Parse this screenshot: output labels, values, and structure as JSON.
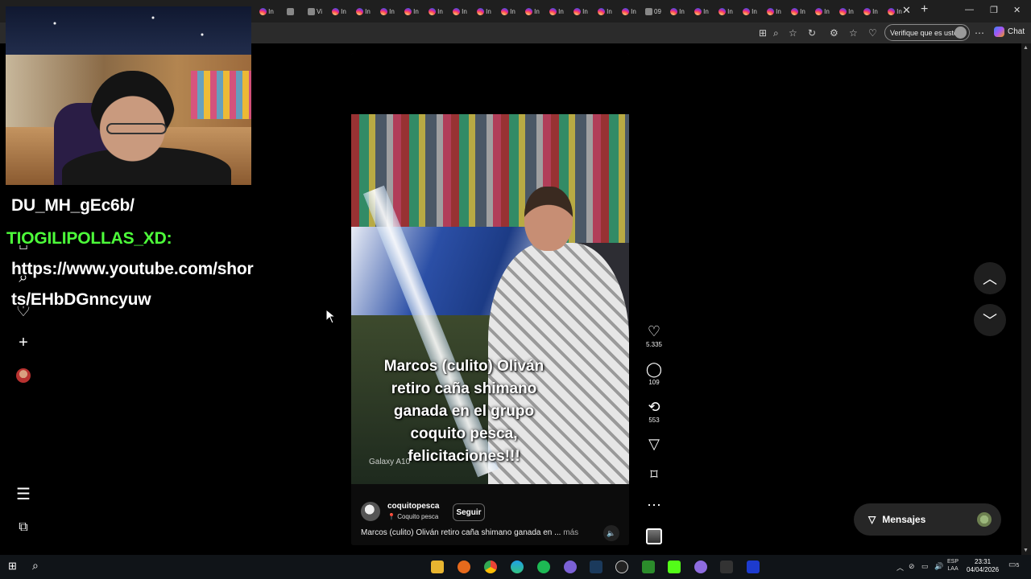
{
  "browser": {
    "tabs": [
      {
        "label": "In",
        "icon": "instagram-favicon"
      },
      {
        "label": "",
        "icon": "generic-favicon"
      },
      {
        "label": "Vi",
        "icon": "generic-favicon"
      },
      {
        "label": "In",
        "icon": "instagram-favicon"
      },
      {
        "label": "In",
        "icon": "instagram-favicon"
      },
      {
        "label": "In",
        "icon": "instagram-favicon"
      },
      {
        "label": "In",
        "icon": "instagram-favicon"
      },
      {
        "label": "In",
        "icon": "instagram-favicon"
      },
      {
        "label": "In",
        "icon": "instagram-favicon"
      },
      {
        "label": "In",
        "icon": "instagram-favicon"
      },
      {
        "label": "In",
        "icon": "instagram-favicon"
      },
      {
        "label": "In",
        "icon": "instagram-favicon"
      },
      {
        "label": "In",
        "icon": "instagram-favicon"
      },
      {
        "label": "In",
        "icon": "instagram-favicon"
      },
      {
        "label": "In",
        "icon": "instagram-favicon"
      },
      {
        "label": "In",
        "icon": "instagram-favicon"
      },
      {
        "label": "09",
        "icon": "generic-favicon"
      },
      {
        "label": "In",
        "icon": "instagram-favicon"
      },
      {
        "label": "In",
        "icon": "instagram-favicon"
      },
      {
        "label": "In",
        "icon": "instagram-favicon"
      },
      {
        "label": "In",
        "icon": "instagram-favicon"
      },
      {
        "label": "In",
        "icon": "instagram-favicon"
      },
      {
        "label": "In",
        "icon": "instagram-favicon"
      },
      {
        "label": "In",
        "icon": "instagram-favicon"
      },
      {
        "label": "In",
        "icon": "instagram-favicon"
      },
      {
        "label": "In",
        "icon": "instagram-favicon"
      },
      {
        "label": "In",
        "icon": "instagram-favicon"
      }
    ],
    "verify_pill": "Verifique que es usted",
    "chat_label": "Chat"
  },
  "stream_chat": {
    "line1": "DU_MH_gEc6b/",
    "user": "TIOGILIPOLLAS_XD:",
    "line2": "https://www.youtube.com/shor",
    "line3": "ts/EHbDGnncyuw"
  },
  "reel": {
    "caption": "Marcos (culito) Oliván retiro caña shimano ganada en el grupo coquito pesca, felicitaciones!!!",
    "watermark": "Galaxy A10",
    "author": "coquitopesca",
    "location": "Coquito pesca",
    "follow_label": "Seguir",
    "description": "Marcos (culito) Oliván retiro caña shimano ganada en ...",
    "more_label": "más",
    "likes": "5.335",
    "comments": "109",
    "reposts": "553"
  },
  "messages_label": "Mensajes",
  "taskbar": {
    "lang_top": "ESP",
    "lang_bottom": "LAA",
    "time": "23:31",
    "date": "04/04/2026",
    "notifications": "5"
  },
  "colors": {
    "chat_username": "#4dff3a",
    "background": "#000000",
    "pill_bg": "#262626"
  }
}
